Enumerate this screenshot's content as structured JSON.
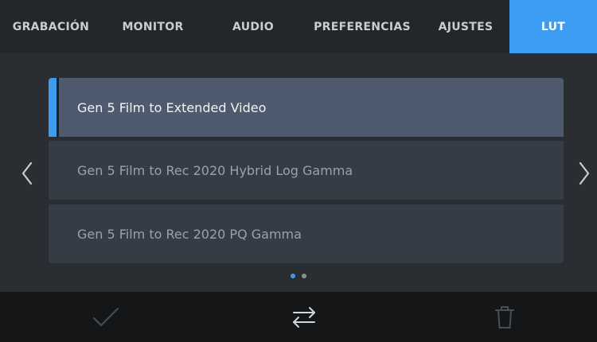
{
  "tabs": [
    {
      "label": "GRABACIÓN",
      "active": false
    },
    {
      "label": "MONITOR",
      "active": false
    },
    {
      "label": "AUDIO",
      "active": false
    },
    {
      "label": "PREFERENCIAS",
      "active": false
    },
    {
      "label": "AJUSTES",
      "active": false
    },
    {
      "label": "LUT",
      "active": true
    }
  ],
  "lut_list": {
    "items": [
      {
        "label": "Gen 5 Film to Extended Video",
        "selected": true
      },
      {
        "label": "Gen 5 Film to Rec 2020 Hybrid Log Gamma",
        "selected": false
      },
      {
        "label": "Gen 5 Film to Rec 2020 PQ Gamma",
        "selected": false
      }
    ]
  },
  "pagination": {
    "current_page": 1,
    "total_pages": 2
  },
  "navigation": {
    "prev_icon": "chevron-left-icon",
    "next_icon": "chevron-right-icon"
  },
  "actions": {
    "confirm_icon": "checkmark-icon",
    "swap_icon": "swap-arrows-icon",
    "delete_icon": "trash-icon"
  },
  "colors": {
    "accent": "#3b9cf2",
    "selected_item": "#4e5a6e",
    "item": "#363c45",
    "background": "#2a2e33"
  }
}
